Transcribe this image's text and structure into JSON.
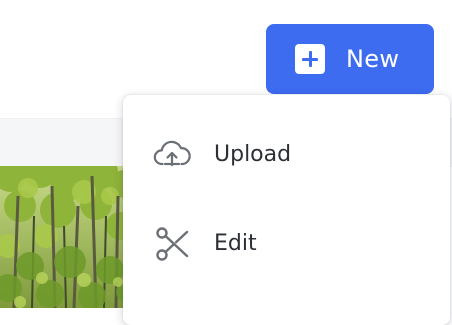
{
  "header": {
    "new_button": {
      "label": "New",
      "icon": "plus-square-icon",
      "color": "#3d6cf0"
    }
  },
  "menu": {
    "items": [
      {
        "label": "Upload",
        "icon": "cloud-upload-icon"
      },
      {
        "label": "Edit",
        "icon": "scissors-icon"
      }
    ]
  },
  "colors": {
    "accent": "#3d6cf0",
    "menu_text": "#2b2f36",
    "icon_gray": "#6b6f76",
    "strip": "#f5f6f8"
  }
}
